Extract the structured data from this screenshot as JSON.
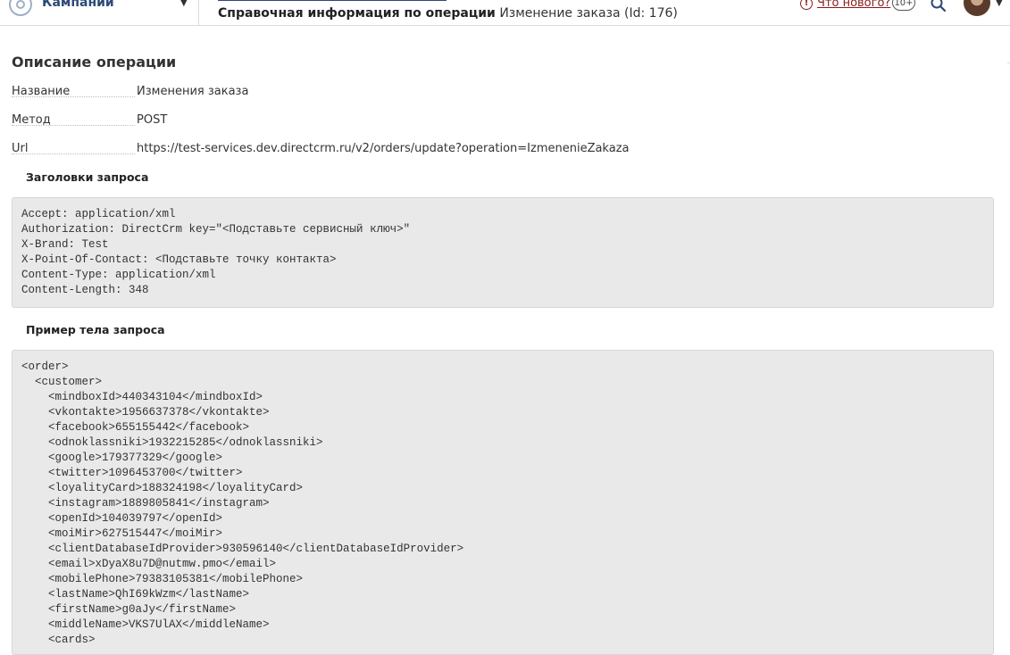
{
  "header": {
    "campaigns_label": "Кампании",
    "title_bold": "Справочная информация по операции",
    "title_rest": "Изменение заказа (Id: 176)",
    "whats_new": "Что нового?",
    "badge": "10+",
    "accent": "#2c4a78",
    "alert_color": "#8b1b1b"
  },
  "section": {
    "title": "Описание операции",
    "fields": [
      {
        "label": "Название",
        "value": "Изменения заказа"
      },
      {
        "label": "Метод",
        "value": "POST"
      },
      {
        "label": "Url",
        "value": "https://test-services.dev.directcrm.ru/v2/orders/update?operation=IzmenenieZakaza"
      }
    ]
  },
  "headers_block": {
    "title": "Заголовки запроса",
    "lines": [
      "Accept: application/xml",
      "Authorization: DirectCrm key=\"<Подставьте сервисный ключ>\"",
      "X-Brand: Test",
      "X-Point-Of-Contact: <Подставьте точку контакта>",
      "Content-Type: application/xml",
      "Content-Length: 348"
    ]
  },
  "body_block": {
    "title": "Пример тела запроса",
    "lines": [
      "<order>",
      "  <customer>",
      "    <mindboxId>440343104</mindboxId>",
      "    <vkontakte>1956637378</vkontakte>",
      "    <facebook>655155442</facebook>",
      "    <odnoklassniki>1932215285</odnoklassniki>",
      "    <google>179377329</google>",
      "    <twitter>1096453700</twitter>",
      "    <loyalityCard>188324198</loyalityCard>",
      "    <instagram>1889805841</instagram>",
      "    <openId>104039797</openId>",
      "    <moiMir>627515447</moiMir>",
      "    <clientDatabaseIdProvider>930596140</clientDatabaseIdProvider>",
      "    <email>xDyaX8u7D@nutmw.pmo</email>",
      "    <mobilePhone>79383105381</mobilePhone>",
      "    <lastName>QhI69kWzm</lastName>",
      "    <firstName>g0aJy</firstName>",
      "    <middleName>VKS7UlAX</middleName>",
      "    <cards>"
    ]
  }
}
